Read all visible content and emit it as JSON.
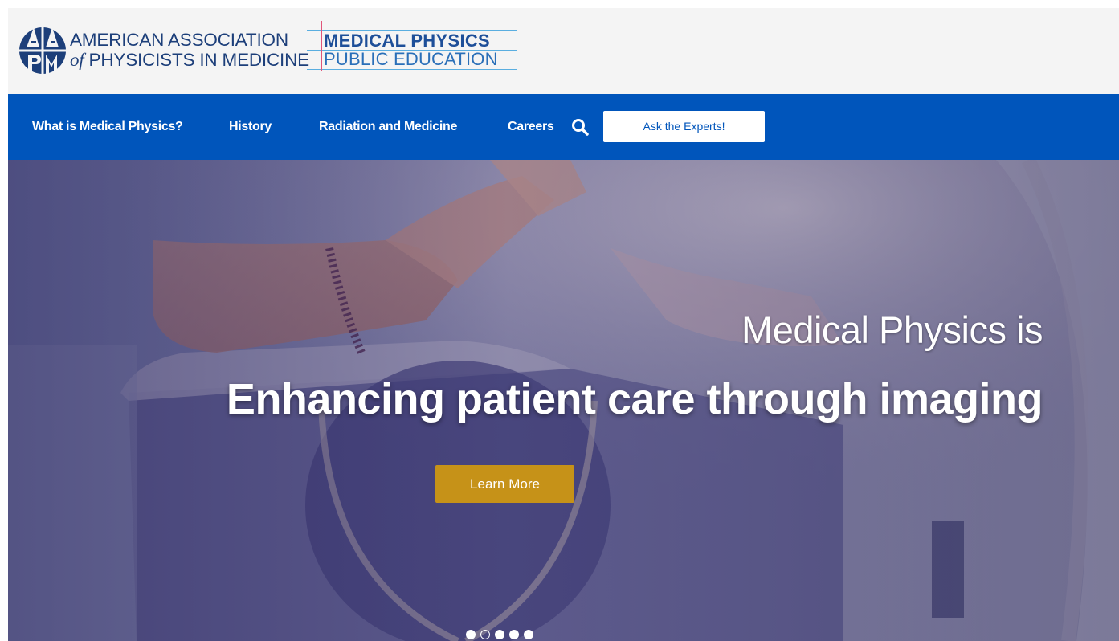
{
  "header": {
    "org_line1": "AMERICAN ASSOCIATION",
    "org_line2_of": "of",
    "org_line2_rest": " PHYSICISTS IN MEDICINE",
    "logo_letters": "AAPM",
    "section_line1": "MEDICAL PHYSICS",
    "section_line2": "PUBLIC EDUCATION"
  },
  "nav": {
    "items": [
      "What is Medical Physics?",
      "History",
      "Radiation and Medicine",
      "Careers"
    ],
    "search_icon": "search-icon",
    "cta_label": "Ask the Experts!"
  },
  "hero": {
    "subheading": "Medical Physics is",
    "headline": "Enhancing patient care through imaging",
    "button_label": "Learn More",
    "slide_count": 5,
    "active_slide": 2
  },
  "colors": {
    "brand_blue": "#0055bb",
    "logo_navy": "#1d3f7a",
    "accent_gold": "#c69218",
    "header_bg": "#f4f4f4"
  }
}
